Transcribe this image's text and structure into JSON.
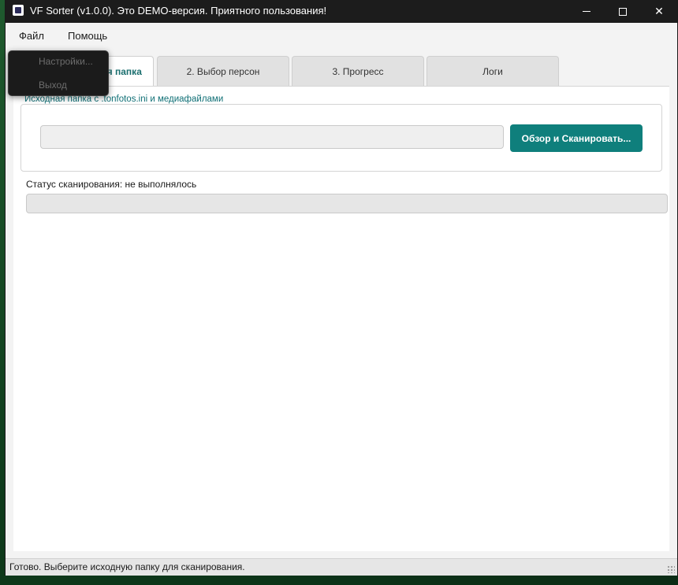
{
  "window": {
    "title": "VF Sorter (v1.0.0). Это DEMO-версия. Приятного пользования!",
    "accent_color": "#0f7f7c"
  },
  "menubar": {
    "file": "Файл",
    "help": "Помощь"
  },
  "file_menu": {
    "settings": "Настройки...",
    "exit": "Выход"
  },
  "tabs": [
    {
      "label": "1. Исходная папка",
      "active": true
    },
    {
      "label": "2. Выбор персон",
      "active": false
    },
    {
      "label": "3. Прогресс",
      "active": false
    },
    {
      "label": "Логи",
      "active": false
    }
  ],
  "source_group": {
    "legend": "Исходная папка с .tonfotos.ini и медиафайлами",
    "path_value": "",
    "browse_button": "Обзор и Сканировать..."
  },
  "scan": {
    "status": "Статус сканирования: не выполнялось",
    "progress": 0
  },
  "statusbar": {
    "text": "Готово. Выберите исходную папку для сканирования."
  }
}
